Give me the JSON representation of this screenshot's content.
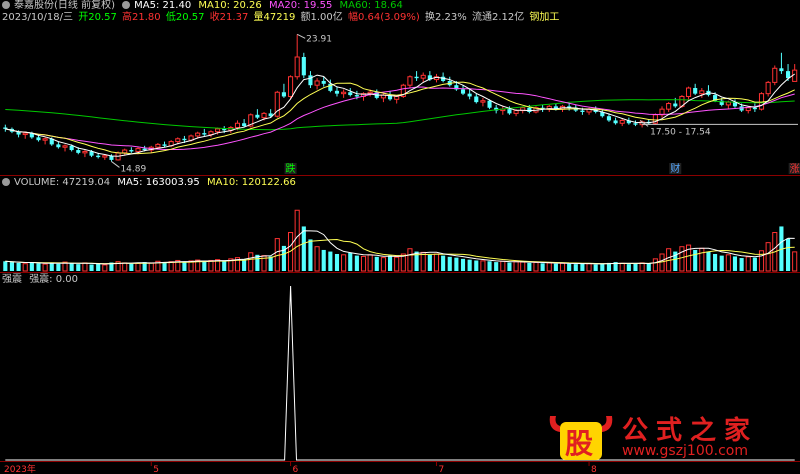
{
  "header_k": {
    "title": "泰嘉股份(日线 前复权)",
    "ma5": "MA5: 21.40",
    "ma10": "MA10: 20.26",
    "ma20": "MA20: 19.55",
    "ma60": "MA60: 18.64",
    "date": "2023/10/18/三",
    "open": "开20.57",
    "high": "高21.80",
    "low": "低20.57",
    "close": "收21.37",
    "volume": "量47219",
    "amount": "额1.00亿",
    "change": "幅0.64(3.09%)",
    "turnover": "换2.23%",
    "float": "流通2.12亿",
    "industry": "钢加工"
  },
  "header_vol": {
    "label": "VOLUME: 47219.04",
    "ma5": "MA5: 163003.95",
    "ma10": "MA10: 120122.66"
  },
  "header_ind": {
    "name": "强震",
    "value": "强震: 0.00"
  },
  "markers": {
    "low_label": "14.89",
    "high_label": "23.91",
    "range_label": "17.50 - 17.54",
    "tag_1": "跌",
    "tag_2": "财",
    "tag_3": "涨"
  },
  "x_axis": [
    "2023年",
    "5",
    "6",
    "7",
    "8"
  ],
  "logo": {
    "glyph": "股",
    "text": "公式之家",
    "url": "www.gszj100.com"
  },
  "colors": {
    "up": "#ff3232",
    "down": "#54ffff",
    "ma5": "#ffffff",
    "ma10": "#ffff54",
    "ma20": "#ff54ff",
    "ma60": "#00c800",
    "grid": "#8b0000"
  },
  "chart_data": [
    {
      "type": "candlestick",
      "title": "泰嘉股份(日线 前复权)",
      "ylim": [
        14.0,
        24.5
      ],
      "candles": [
        [
          17.3,
          17.5,
          17.0,
          17.2
        ],
        [
          17.2,
          17.3,
          16.9,
          17.0
        ],
        [
          17.0,
          17.1,
          16.6,
          16.8
        ],
        [
          16.8,
          17.0,
          16.5,
          16.9
        ],
        [
          16.9,
          17.0,
          16.5,
          16.6
        ],
        [
          16.6,
          16.8,
          16.3,
          16.4
        ],
        [
          16.4,
          16.6,
          16.1,
          16.5
        ],
        [
          16.5,
          16.6,
          16.0,
          16.1
        ],
        [
          16.1,
          16.3,
          15.8,
          15.9
        ],
        [
          15.9,
          16.1,
          15.6,
          16.0
        ],
        [
          16.0,
          16.1,
          15.6,
          15.7
        ],
        [
          15.7,
          15.9,
          15.4,
          15.5
        ],
        [
          15.5,
          15.7,
          15.2,
          15.6
        ],
        [
          15.6,
          15.7,
          15.2,
          15.3
        ],
        [
          15.3,
          15.5,
          15.1,
          15.2
        ],
        [
          15.2,
          15.4,
          15.0,
          15.3
        ],
        [
          15.3,
          15.4,
          14.89,
          15.0
        ],
        [
          15.0,
          15.6,
          14.95,
          15.5
        ],
        [
          15.5,
          15.8,
          15.3,
          15.7
        ],
        [
          15.7,
          15.9,
          15.5,
          15.6
        ],
        [
          15.6,
          15.9,
          15.4,
          15.8
        ],
        [
          15.8,
          16.0,
          15.6,
          15.7
        ],
        [
          15.7,
          16.0,
          15.5,
          15.9
        ],
        [
          15.9,
          16.2,
          15.8,
          16.1
        ],
        [
          16.1,
          16.3,
          15.9,
          16.0
        ],
        [
          16.0,
          16.4,
          15.9,
          16.3
        ],
        [
          16.3,
          16.6,
          16.1,
          16.5
        ],
        [
          16.5,
          16.7,
          16.2,
          16.4
        ],
        [
          16.4,
          16.8,
          16.3,
          16.7
        ],
        [
          16.7,
          17.0,
          16.5,
          16.9
        ],
        [
          16.9,
          17.2,
          16.7,
          16.8
        ],
        [
          16.8,
          17.1,
          16.6,
          17.0
        ],
        [
          17.0,
          17.3,
          16.8,
          17.2
        ],
        [
          17.2,
          17.4,
          16.9,
          17.1
        ],
        [
          17.1,
          17.4,
          16.9,
          17.3
        ],
        [
          17.3,
          17.8,
          17.1,
          17.6
        ],
        [
          17.6,
          17.9,
          17.3,
          17.4
        ],
        [
          17.4,
          18.3,
          17.3,
          18.2
        ],
        [
          18.2,
          18.6,
          17.9,
          18.0
        ],
        [
          18.0,
          18.4,
          17.8,
          18.3
        ],
        [
          18.3,
          18.6,
          18.0,
          18.1
        ],
        [
          18.1,
          19.9,
          18.0,
          19.8
        ],
        [
          19.8,
          20.4,
          19.4,
          19.5
        ],
        [
          19.5,
          21.0,
          19.3,
          20.9
        ],
        [
          20.9,
          23.91,
          20.7,
          22.3
        ],
        [
          22.3,
          22.6,
          20.8,
          21.0
        ],
        [
          21.0,
          21.3,
          20.1,
          20.3
        ],
        [
          20.3,
          20.8,
          20.0,
          20.6
        ],
        [
          20.6,
          20.9,
          20.2,
          20.4
        ],
        [
          20.4,
          20.7,
          19.8,
          19.9
        ],
        [
          19.9,
          20.2,
          19.5,
          19.7
        ],
        [
          19.7,
          20.0,
          19.4,
          19.8
        ],
        [
          19.8,
          20.1,
          19.5,
          19.6
        ],
        [
          19.6,
          19.9,
          19.3,
          19.5
        ],
        [
          19.5,
          19.8,
          19.2,
          19.7
        ],
        [
          19.7,
          20.0,
          19.5,
          19.8
        ],
        [
          19.8,
          20.0,
          19.3,
          19.4
        ],
        [
          19.4,
          19.7,
          19.1,
          19.6
        ],
        [
          19.6,
          19.9,
          19.2,
          19.3
        ],
        [
          19.3,
          19.6,
          19.0,
          19.5
        ],
        [
          19.5,
          20.4,
          19.4,
          20.3
        ],
        [
          20.3,
          21.0,
          20.1,
          20.9
        ],
        [
          20.9,
          21.3,
          20.6,
          20.8
        ],
        [
          20.8,
          21.2,
          20.5,
          21.0
        ],
        [
          21.0,
          21.3,
          20.6,
          20.7
        ],
        [
          20.7,
          21.1,
          20.5,
          20.9
        ],
        [
          20.9,
          21.2,
          20.5,
          20.6
        ],
        [
          20.6,
          20.9,
          20.2,
          20.3
        ],
        [
          20.3,
          20.6,
          19.9,
          20.0
        ],
        [
          20.0,
          20.3,
          19.6,
          19.7
        ],
        [
          19.7,
          20.0,
          19.3,
          19.5
        ],
        [
          19.5,
          19.7,
          19.0,
          19.1
        ],
        [
          19.1,
          19.4,
          18.8,
          19.2
        ],
        [
          19.2,
          19.3,
          18.6,
          18.7
        ],
        [
          18.7,
          18.9,
          18.3,
          18.5
        ],
        [
          18.5,
          18.8,
          18.2,
          18.6
        ],
        [
          18.6,
          18.8,
          18.2,
          18.3
        ],
        [
          18.3,
          18.6,
          18.1,
          18.5
        ],
        [
          18.5,
          18.8,
          18.3,
          18.7
        ],
        [
          18.7,
          18.9,
          18.3,
          18.4
        ],
        [
          18.4,
          18.8,
          18.3,
          18.7
        ],
        [
          18.7,
          18.9,
          18.4,
          18.6
        ],
        [
          18.6,
          18.9,
          18.4,
          18.8
        ],
        [
          18.8,
          19.0,
          18.5,
          18.6
        ],
        [
          18.6,
          18.9,
          18.4,
          18.8
        ],
        [
          18.8,
          19.0,
          18.5,
          18.7
        ],
        [
          18.7,
          18.9,
          18.4,
          18.5
        ],
        [
          18.5,
          18.7,
          18.2,
          18.4
        ],
        [
          18.4,
          18.7,
          18.2,
          18.6
        ],
        [
          18.6,
          18.8,
          18.3,
          18.4
        ],
        [
          18.4,
          18.6,
          18.0,
          18.1
        ],
        [
          18.1,
          18.3,
          17.7,
          17.8
        ],
        [
          17.8,
          18.0,
          17.5,
          17.6
        ],
        [
          17.6,
          17.9,
          17.4,
          17.8
        ],
        [
          17.8,
          18.0,
          17.5,
          17.6
        ],
        [
          17.6,
          17.8,
          17.4,
          17.5
        ],
        [
          17.5,
          17.8,
          17.3,
          17.7
        ],
        [
          17.7,
          17.9,
          17.5,
          17.6
        ],
        [
          17.6,
          18.3,
          17.5,
          18.2
        ],
        [
          18.2,
          18.8,
          18.0,
          18.6
        ],
        [
          18.6,
          19.1,
          18.4,
          19.0
        ],
        [
          19.0,
          19.4,
          18.7,
          18.8
        ],
        [
          18.8,
          19.6,
          18.7,
          19.5
        ],
        [
          19.5,
          20.2,
          19.3,
          20.1
        ],
        [
          20.1,
          20.4,
          19.6,
          19.7
        ],
        [
          19.7,
          20.1,
          19.4,
          19.9
        ],
        [
          19.9,
          20.3,
          19.5,
          19.6
        ],
        [
          19.6,
          19.8,
          19.1,
          19.2
        ],
        [
          19.2,
          19.4,
          18.8,
          18.9
        ],
        [
          18.9,
          19.2,
          18.6,
          19.1
        ],
        [
          19.1,
          19.3,
          18.7,
          18.8
        ],
        [
          18.8,
          19.0,
          18.4,
          18.5
        ],
        [
          18.5,
          18.8,
          18.3,
          18.7
        ],
        [
          18.7,
          19.0,
          18.4,
          18.6
        ],
        [
          18.6,
          19.8,
          18.5,
          19.7
        ],
        [
          19.7,
          20.6,
          19.5,
          20.5
        ],
        [
          20.5,
          21.7,
          20.3,
          21.5
        ],
        [
          21.5,
          22.6,
          21.1,
          21.3
        ],
        [
          21.3,
          21.8,
          20.6,
          20.8
        ],
        [
          20.57,
          21.8,
          20.57,
          21.37
        ]
      ],
      "ma_lines": [
        "MA5",
        "MA10",
        "MA20",
        "MA60"
      ],
      "annotations": [
        "14.89",
        "23.91",
        "17.50 - 17.54",
        "跌",
        "财",
        "涨"
      ]
    },
    {
      "type": "bar",
      "title": "VOLUME",
      "ylim": [
        0,
        200000
      ],
      "values": [
        24000,
        22000,
        20000,
        18000,
        21000,
        19000,
        17000,
        20000,
        18000,
        22000,
        19000,
        17000,
        20000,
        16000,
        18000,
        15000,
        21000,
        23000,
        20000,
        18000,
        19000,
        22000,
        20000,
        24000,
        21000,
        23000,
        26000,
        22000,
        25000,
        27000,
        23000,
        26000,
        28000,
        24000,
        30000,
        33000,
        29000,
        45000,
        40000,
        38000,
        36000,
        80000,
        62000,
        95000,
        150000,
        110000,
        78000,
        60000,
        52000,
        48000,
        42000,
        40000,
        45000,
        38000,
        36000,
        40000,
        35000,
        33000,
        38000,
        34000,
        42000,
        55000,
        48000,
        46000,
        40000,
        42000,
        38000,
        35000,
        33000,
        30000,
        28000,
        26000,
        25000,
        24000,
        22000,
        24000,
        21000,
        23000,
        22000,
        20000,
        21000,
        19000,
        20000,
        18000,
        19000,
        18000,
        17000,
        19000,
        18000,
        16000,
        18000,
        20000,
        22000,
        19000,
        17000,
        18000,
        20000,
        19000,
        30000,
        42000,
        55000,
        48000,
        60000,
        64000,
        52000,
        56000,
        48000,
        42000,
        38000,
        40000,
        36000,
        32000,
        35000,
        33000,
        50000,
        70000,
        95000,
        110000,
        80000,
        47219
      ],
      "ma_lines": [
        "MA5",
        "MA10"
      ]
    },
    {
      "type": "line",
      "title": "强震",
      "ylim": [
        0,
        1
      ],
      "values_note": "zero everywhere except a single spike",
      "values": [
        0,
        0,
        0,
        0,
        0,
        0,
        0,
        0,
        0,
        0,
        0,
        0,
        0,
        0,
        0,
        0,
        0,
        0,
        0,
        0,
        0,
        0,
        0,
        0,
        0,
        0,
        0,
        0,
        0,
        0,
        0,
        0,
        0,
        0,
        0,
        0,
        0,
        0,
        0,
        0,
        0,
        0,
        0,
        1,
        0,
        0,
        0,
        0,
        0,
        0,
        0,
        0,
        0,
        0,
        0,
        0,
        0,
        0,
        0,
        0,
        0,
        0,
        0,
        0,
        0,
        0,
        0,
        0,
        0,
        0,
        0,
        0,
        0,
        0,
        0,
        0,
        0,
        0,
        0,
        0,
        0,
        0,
        0,
        0,
        0,
        0,
        0,
        0,
        0,
        0,
        0,
        0,
        0,
        0,
        0,
        0,
        0,
        0,
        0,
        0,
        0,
        0,
        0,
        0,
        0,
        0,
        0,
        0,
        0,
        0,
        0,
        0,
        0,
        0,
        0,
        0,
        0,
        0,
        0,
        0
      ]
    }
  ]
}
